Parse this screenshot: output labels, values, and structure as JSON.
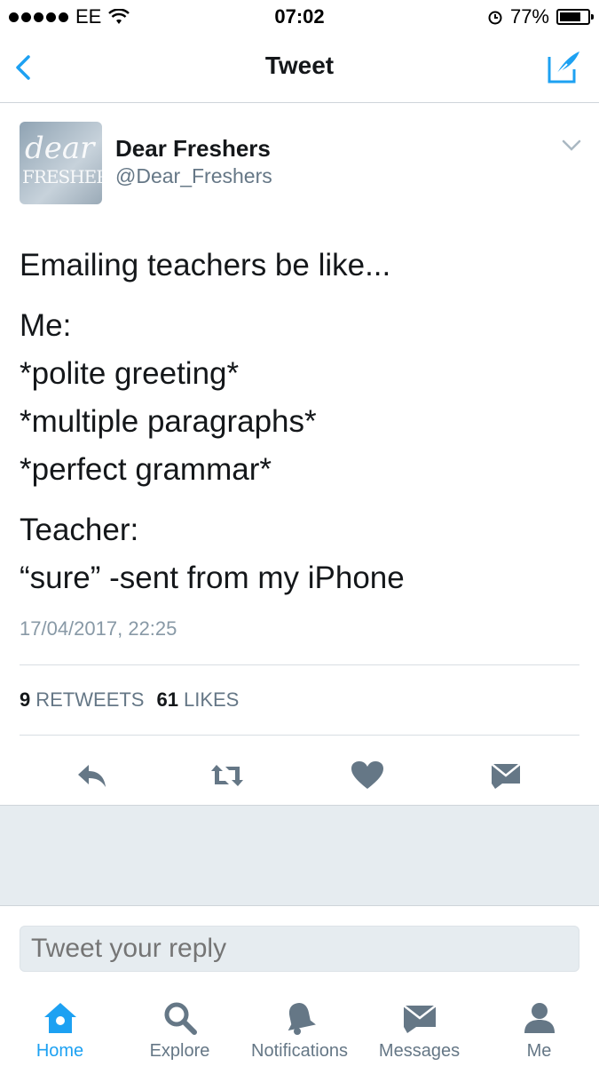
{
  "status_bar": {
    "carrier": "EE",
    "time": "07:02",
    "battery": "77%",
    "battery_level": 0.77
  },
  "nav": {
    "title": "Tweet"
  },
  "tweet": {
    "author_name": "Dear Freshers",
    "author_handle": "@Dear_Freshers",
    "avatar_text_1": "dear",
    "avatar_text_2": "FRESHERS",
    "lines": [
      "Emailing teachers be like...",
      "Me:",
      "*polite greeting*",
      "*multiple paragraphs*",
      "*perfect grammar*",
      "Teacher:",
      "“sure” -sent from my iPhone"
    ],
    "timestamp": "17/04/2017, 22:25",
    "retweets_count": "9",
    "retweets_label": "RETWEETS",
    "likes_count": "61",
    "likes_label": "LIKES"
  },
  "reply": {
    "placeholder": "Tweet your reply"
  },
  "tabs": [
    {
      "label": "Home",
      "icon": "home-icon",
      "active": true
    },
    {
      "label": "Explore",
      "icon": "search-icon",
      "active": false
    },
    {
      "label": "Notifications",
      "icon": "bell-icon",
      "active": false
    },
    {
      "label": "Messages",
      "icon": "envelope-icon",
      "active": false
    },
    {
      "label": "Me",
      "icon": "person-icon",
      "active": false
    }
  ],
  "colors": {
    "accent": "#1da1f2",
    "muted": "#657786",
    "icon_gray": "#657786",
    "background_gray": "#e6ecf0"
  }
}
